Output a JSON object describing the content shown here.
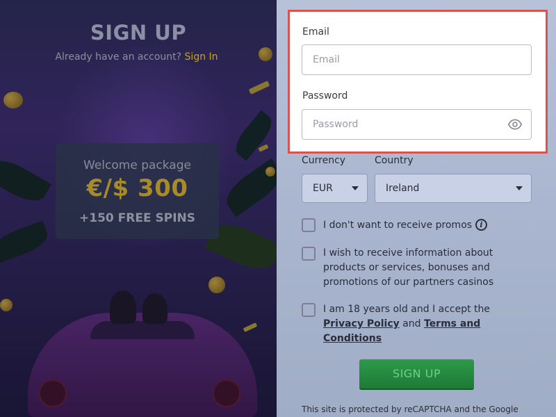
{
  "signup": {
    "title": "SIGN UP",
    "have_account": "Already have an account?",
    "signin_link": "Sign In"
  },
  "welcome": {
    "line1": "Welcome package",
    "amount": "€/$ 300",
    "spins": "+150 FREE SPINS"
  },
  "form": {
    "email_label": "Email",
    "email_placeholder": "Email",
    "password_label": "Password",
    "password_placeholder": "Password",
    "currency_label": "Currency",
    "currency_value": "EUR",
    "country_label": "Country",
    "country_value": "Ireland",
    "promo_opt_out": "I don't want to receive promos",
    "partner_info": "I wish to receive information about products or services, bonuses and promotions of our partners casinos",
    "age_prefix": "I am 18 years old and I accept the",
    "privacy_link": "Privacy Policy",
    "and": "and",
    "terms_link": "Terms and Conditions",
    "submit": "SIGN UP",
    "recaptcha": "This site is protected by reCAPTCHA and the Google"
  },
  "icons": {
    "eye": "eye-icon",
    "info": "info-icon",
    "caret": "chevron-down-icon"
  },
  "colors": {
    "highlight_border": "#d9534f",
    "signup_button": "#1e7a36",
    "link_gold": "#c9a228"
  }
}
